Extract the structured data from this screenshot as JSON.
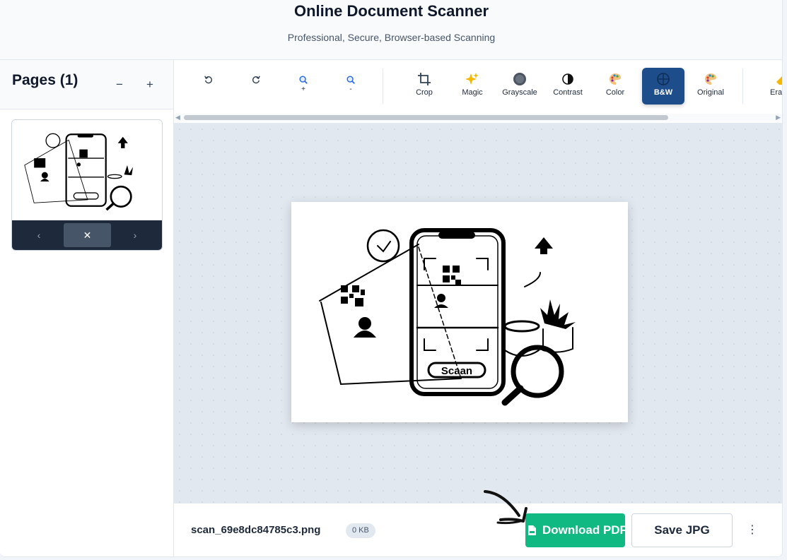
{
  "header": {
    "title": "Online Document Scanner",
    "subtitle": "Professional, Secure, Browser-based Scanning"
  },
  "sidebar": {
    "title": "Pages (1)",
    "zoom_out": "−",
    "zoom_in": "+",
    "thumb_nav": {
      "prev": "‹",
      "delete": "✕",
      "next": "›"
    }
  },
  "toolbar": {
    "rotate_left": {
      "icon": "rotate-left-icon",
      "label": ""
    },
    "rotate_right": {
      "icon": "rotate-right-icon",
      "label": ""
    },
    "zoom_in": {
      "icon": "zoom-in-icon",
      "label": "+"
    },
    "zoom_out": {
      "icon": "zoom-out-icon",
      "label": "-"
    },
    "filters": [
      {
        "key": "crop",
        "label": "Crop",
        "icon": "crop-icon"
      },
      {
        "key": "magic",
        "label": "Magic",
        "icon": "sparkles-icon"
      },
      {
        "key": "grayscale",
        "label": "Grayscale",
        "icon": "grayscale-icon"
      },
      {
        "key": "contrast",
        "label": "Contrast",
        "icon": "contrast-icon"
      },
      {
        "key": "color",
        "label": "Color",
        "icon": "palette-icon"
      },
      {
        "key": "bw",
        "label": "B&W",
        "icon": "crosshair-circle-icon",
        "active": true
      },
      {
        "key": "original",
        "label": "Original",
        "icon": "palette-icon"
      },
      {
        "key": "erase",
        "label": "Era",
        "icon": "eraser-icon"
      }
    ],
    "active_color": "#1e4d8c"
  },
  "footer": {
    "filename": "scan_69e8dc84785c3.png",
    "size": "0 KB",
    "download_pdf": "Download PDF",
    "save_jpg": "Save JPG",
    "more": "⋮"
  },
  "colors": {
    "primary_green": "#10b981",
    "dark_nav": "#1e293b",
    "canvas_bg": "#e2e8f0"
  }
}
